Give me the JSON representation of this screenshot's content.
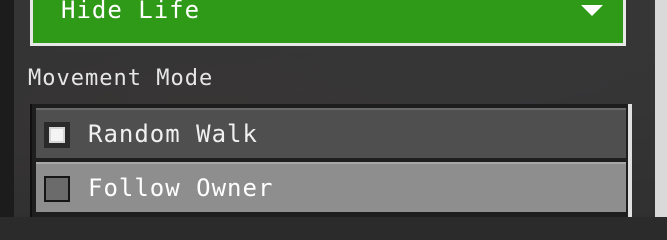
{
  "dropdown": {
    "selected": "Hide Life",
    "icon": "caret-down-icon",
    "color": "#2f9a18"
  },
  "movement": {
    "label": "Movement Mode",
    "options": [
      {
        "label": "Random Walk",
        "checked": true
      },
      {
        "label": "Follow Owner",
        "checked": false
      }
    ]
  }
}
